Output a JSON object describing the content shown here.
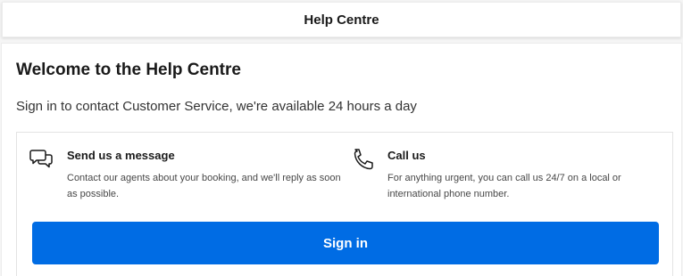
{
  "header": {
    "title": "Help Centre"
  },
  "welcome": {
    "title": "Welcome to the Help Centre",
    "subtitle": "Sign in to contact Customer Service, we're available 24 hours a day"
  },
  "contact_options": [
    {
      "icon": "chat-bubbles-icon",
      "title": "Send us a message",
      "description": "Contact our agents about your booking, and we'll reply as soon as possible."
    },
    {
      "icon": "phone-icon",
      "title": "Call us",
      "description": "For anything urgent, you can call us 24/7 on a local or international phone number."
    }
  ],
  "actions": {
    "sign_in_label": "Sign in"
  },
  "colors": {
    "primary_button": "#006ce4",
    "text": "#1a1a1a"
  }
}
